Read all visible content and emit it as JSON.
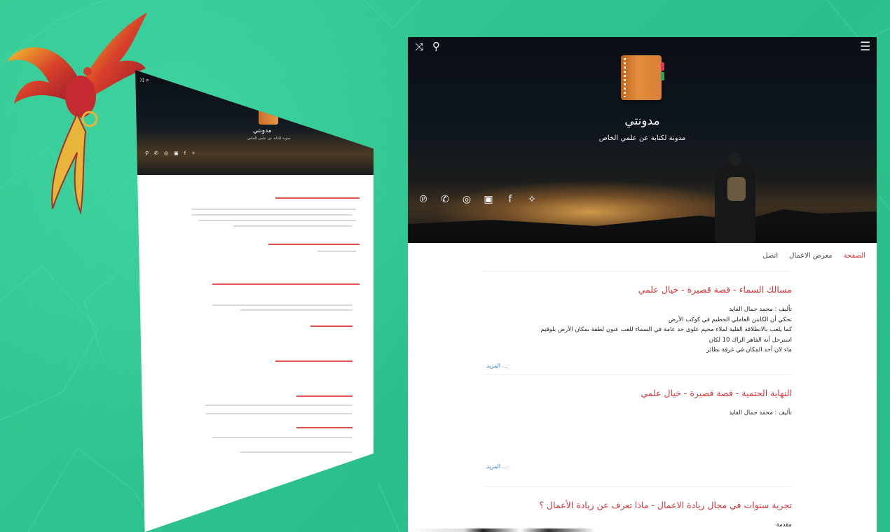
{
  "site": {
    "title": "مدونتي",
    "subtitle": "مدونة لكتابة عن علمي الخاص"
  },
  "toolbar": {
    "shuffle_icon": "shuffle-icon",
    "search_icon": "search-icon",
    "menu_icon": "menu-icon"
  },
  "social": [
    "pinterest-icon",
    "phone-icon",
    "whatsapp-icon",
    "instagram-icon",
    "facebook-icon",
    "twitter-icon"
  ],
  "nav": {
    "items": [
      {
        "label": "الصفحة",
        "active": true
      },
      {
        "label": "معرض الاعمال",
        "active": false
      },
      {
        "label": "اتصل",
        "active": false
      }
    ]
  },
  "posts": [
    {
      "title": "مسالك السماء - قصة قصيرة - خيال علمي",
      "lines": [
        "تأليف : محمد جمال الفايد",
        "تحكي أن الكابتن العاملي الحظيم في كوكب الأرض",
        "كما يلعب بالانطلاقة الفلية لملاء مخيم علوى حد عامة في السماء للعب عنون لطفة بمكان الأرض بلوقيم",
        "استرحل أنه الفاهر الراك 10 لكان",
        "ماء لان أحد المكان في غرفة نظائر"
      ],
      "readmore": "المزيد ..."
    },
    {
      "title": "النهاية الحتمية - قصة قصيرة - خيال علمي",
      "lines": [
        "تأليف : محمد جمال الفايد"
      ],
      "readmore": "المزيد ..."
    },
    {
      "title": "تجربة سنوات في مجال ريادة الاعمال - ماذا تعرف عن ريادة الأعمال ؟",
      "lines": [
        "مقدمة"
      ],
      "readmore": ""
    }
  ],
  "mini_preview": {
    "title": "مدونتي",
    "subtitle": "مدونة لكتابة عن علمي الخاص"
  },
  "colors": {
    "accent": "#d9333a",
    "background": "#2fc48f",
    "link": "#3a78c9"
  }
}
